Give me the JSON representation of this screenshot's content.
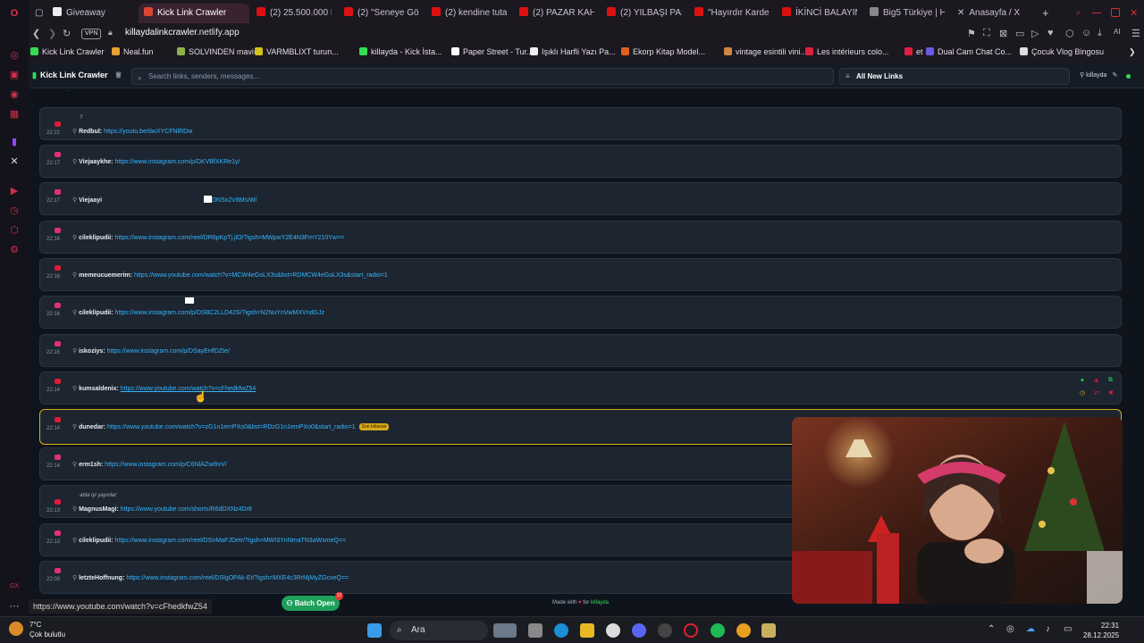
{
  "browser": {
    "tabs": [
      {
        "label": "Giveaway"
      },
      {
        "label": "Kick Link Crawler"
      },
      {
        "label": "(2) 25.500.000 De"
      },
      {
        "label": "(2) \"Seneye Görü"
      },
      {
        "label": "(2) kendine tutam"
      },
      {
        "label": "(2) PAZAR KAHVA"
      },
      {
        "label": "(2) YILBAŞI PASTA"
      },
      {
        "label": "\"Hayırdır Kardeş\""
      },
      {
        "label": "İKİNCİ BALAYIMIZ"
      },
      {
        "label": "Big5 Türkiye | Ha"
      },
      {
        "label": "Anasayfa / X"
      }
    ],
    "vpn_label": "VPN",
    "url_host": "killaydalinkcrawler",
    "url_rest": ".netlify.app",
    "bookmarks": [
      {
        "label": "Kick Link Crawler",
        "color": "#33dd55"
      },
      {
        "label": "Neal.fun",
        "color": "#e8a030"
      },
      {
        "label": "SOLVINDEN mavi-...",
        "color": "#8fb34a"
      },
      {
        "label": "VARMBLIXT turun...",
        "color": "#d4c11a"
      },
      {
        "label": "killayda - Kick İsta...",
        "color": "#33dd55"
      },
      {
        "label": "Paper Street - Tur...",
        "color": "#ffffff"
      },
      {
        "label": "Işıklı Harfli Yazı Pa...",
        "color": "#eeeeee"
      },
      {
        "label": "Ekorp Kitap Model...",
        "color": "#e06020"
      },
      {
        "label": "vintage esintili vini...",
        "color": "#cc8844"
      },
      {
        "label": "Les intérieurs colo...",
        "color": "#e02040"
      },
      {
        "label": "et",
        "color": "#e02040"
      },
      {
        "label": "Dual Cam Chat Co...",
        "color": "#6a5ae0"
      },
      {
        "label": "Çocuk Vlog Bingosu",
        "color": "#dddddd"
      }
    ]
  },
  "app": {
    "title": "Kick Link Crawler",
    "search_placeholder": "Search links, senders, messages...",
    "filter_label": "All New Links",
    "username": "killayda"
  },
  "feed": [
    {
      "time": "22:22",
      "platform": "youtube",
      "sender": "Redbul:",
      "link": "https://youtu.be/dwXYCFNlRDw",
      "note": "?"
    },
    {
      "time": "22:17",
      "platform": "instagram",
      "sender": "Viejaaykhe:",
      "link": "https://www.instagram.com/p/DKVBfXKRe1y/"
    },
    {
      "time": "22:17",
      "platform": "instagram",
      "sender": "Viejaayi",
      "link": "DNSx2V8MsIW/"
    },
    {
      "time": "22:16",
      "platform": "instagram",
      "sender": "cileklipudii:",
      "link": "https://www.instagram.com/reel/DR6pKpTj.jlO/?igsh=MWpwY2E4N3FmY210Yw=="
    },
    {
      "time": "22:16",
      "platform": "youtube",
      "sender": "memeucuemerim:",
      "link": "https://www.youtube.com/watch?v=MCW4eGoLX3s&list=RDMCW4eGoLX3s&start_radio=1"
    },
    {
      "time": "22:16",
      "platform": "instagram",
      "sender": "cileklipudii:",
      "link": "https://www.instagram.com/p/DSBC2LLD42S/?igsh=N2NuYnVwMXVndGJz"
    },
    {
      "time": "22:15",
      "platform": "instagram",
      "sender": "iskoziys:",
      "link": "https://www.instagram.com/p/DSayEHfDZte/"
    },
    {
      "time": "22:14",
      "platform": "youtube",
      "sender": "kumsaldenix:",
      "link": "https://www.youtube.com/watch?v=cFhedkfwZ54"
    },
    {
      "time": "22:14",
      "platform": "youtube",
      "sender": "dunedar:",
      "link": "https://www.youtube.com/watch?v=zG1n1emPXo0&list=RDzG1n1emPXo0&start_radio=1",
      "badge": "Son tıklanan"
    },
    {
      "time": "22:14",
      "platform": "instagram",
      "sender": "erm1sh:",
      "link": "https://www.instagram.com/p/C6NlAZwi9vV/"
    },
    {
      "time": "22:13",
      "platform": "youtube",
      "sender": "MagnusMagi:",
      "link": "https://www.youtube.com/shorts/R6dDXNz4Dr8",
      "note": "abla iyi yayınlar"
    },
    {
      "time": "22:13",
      "platform": "instagram",
      "sender": "cileklipudii:",
      "link": "https://www.instagram.com/reel/DSnMaFJDetr/?igsh=MWI3YnNmaTN3aWxmeQ=="
    },
    {
      "time": "22:09",
      "platform": "instagram",
      "sender": "letzteHoffnung:",
      "link": "https://www.instagram.com/reel/DSlgOPAk-Et/?igsh=MXE4c3RrMjMyZGcxeQ=="
    }
  ],
  "footer": {
    "batch_label": "Batch Open",
    "batch_count": "17",
    "made_prefix": "Made with",
    "made_for": "for",
    "made_name": "killayda",
    "status_url": "https://www.youtube.com/watch?v=cFhedkfwZ54"
  },
  "taskbar": {
    "temperature": "7°C",
    "weather": "Çok bulutlu",
    "search": "Ara",
    "time": "22:31",
    "date": "28.12.2025"
  },
  "colors": {
    "youtube": "#e01c3a",
    "instagram": "#e0307a",
    "link": "#38b6ff",
    "highlight": "#d6b11a",
    "kick_green": "#33dd55"
  }
}
